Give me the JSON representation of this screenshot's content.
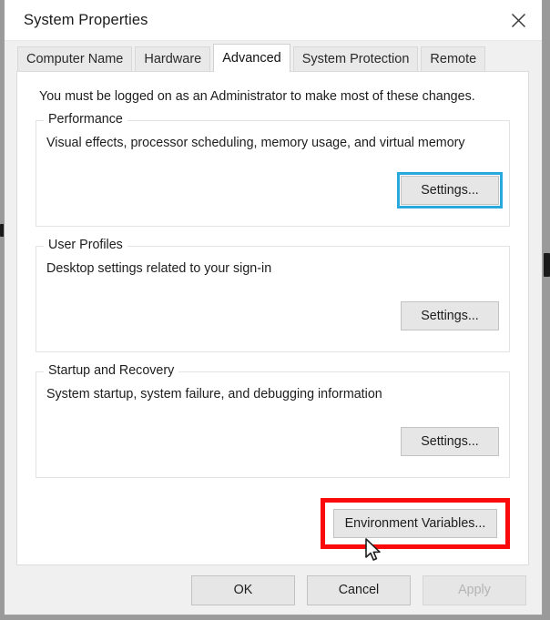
{
  "window": {
    "title": "System Properties",
    "close_icon": "close-icon"
  },
  "tabs": [
    {
      "label": "Computer Name",
      "selected": false
    },
    {
      "label": "Hardware",
      "selected": false
    },
    {
      "label": "Advanced",
      "selected": true
    },
    {
      "label": "System Protection",
      "selected": false
    },
    {
      "label": "Remote",
      "selected": false
    }
  ],
  "main": {
    "admin_notice": "You must be logged on as an Administrator to make most of these changes.",
    "groups": [
      {
        "legend": "Performance",
        "description": "Visual effects, processor scheduling, memory usage, and virtual memory",
        "button_label": "Settings...",
        "button_focused": true
      },
      {
        "legend": "User Profiles",
        "description": "Desktop settings related to your sign-in",
        "button_label": "Settings...",
        "button_focused": false
      },
      {
        "legend": "Startup and Recovery",
        "description": "System startup, system failure, and debugging information",
        "button_label": "Settings...",
        "button_focused": false
      }
    ],
    "environment_variables": {
      "button_label": "Environment Variables...",
      "highlight_color": "#fa0a0a"
    }
  },
  "footer": {
    "ok_label": "OK",
    "cancel_label": "Cancel",
    "apply_label": "Apply",
    "apply_disabled": true
  },
  "colors": {
    "focus_ring": "#29a8dd",
    "annotation": "#fa0a0a",
    "window_bg": "#f0f0f0",
    "panel_bg": "#ffffff"
  },
  "cursor": {
    "type": "arrow-pointer"
  }
}
